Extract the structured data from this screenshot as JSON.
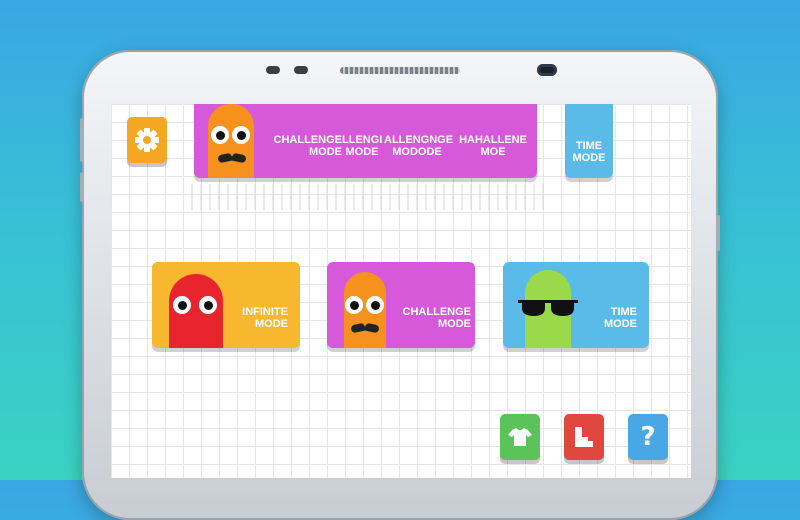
{
  "top_banner": {
    "labels": [
      {
        "line1": "CHALLENGE",
        "line2": "MODE"
      },
      {
        "line1": "LLENGI",
        "line2": "MODE"
      },
      {
        "line1": "ALLENGNGE",
        "line2": "MODODE"
      },
      {
        "line1": "HAHALLENE",
        "line2": "MOE"
      }
    ]
  },
  "time_tab": {
    "line1": "TIME",
    "line2": "MODE"
  },
  "modes": [
    {
      "line1": "INFINITE",
      "line2": "MODE",
      "color": "#f7b72e",
      "char_color": "#e8252e"
    },
    {
      "line1": "CHALLENGE",
      "line2": "MODE",
      "color": "#d659d9",
      "char_color": "#f7911e"
    },
    {
      "line1": "TIME",
      "line2": "MODE",
      "color": "#5bbbe8",
      "char_color": "#9ad94a"
    }
  ],
  "colors": {
    "settings": "#f5a623",
    "shop": "#5cc25a",
    "leaderboard": "#e0483f",
    "help": "#4aa7e6"
  },
  "buttons": {
    "help_glyph": "?"
  }
}
